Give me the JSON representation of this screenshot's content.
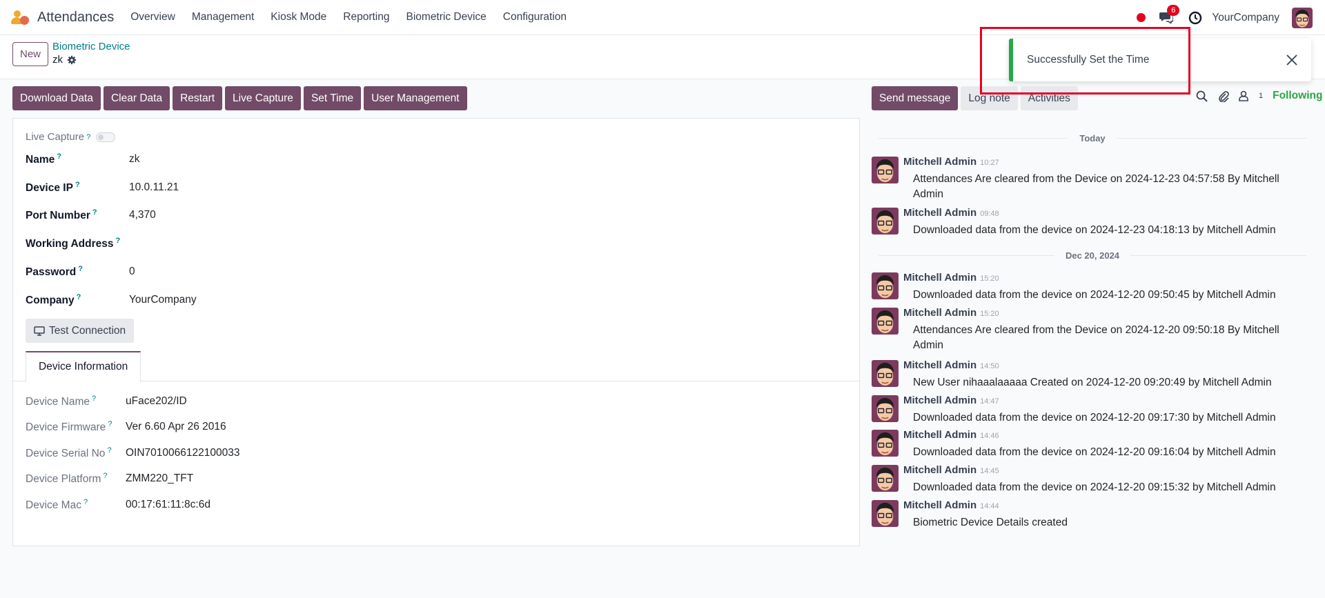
{
  "app": {
    "name": "Attendances"
  },
  "menu": [
    "Overview",
    "Management",
    "Kiosk Mode",
    "Reporting",
    "Biometric Device",
    "Configuration"
  ],
  "systray": {
    "chat_count": "6",
    "company": "YourCompany"
  },
  "control": {
    "new_label": "New",
    "breadcrumb_parent": "Biometric Device",
    "breadcrumb_current": "zk"
  },
  "actions": [
    "Download Data",
    "Clear Data",
    "Restart",
    "Live Capture",
    "Set Time",
    "User Management"
  ],
  "form": {
    "live_capture_label": "Live Capture",
    "fields": [
      {
        "label": "Name",
        "value": "zk"
      },
      {
        "label": "Device IP",
        "value": "10.0.11.21"
      },
      {
        "label": "Port Number",
        "value": "4,370"
      },
      {
        "label": "Working Address",
        "value": ""
      },
      {
        "label": "Password",
        "value": "0"
      },
      {
        "label": "Company",
        "value": "YourCompany"
      }
    ],
    "test_connection_label": "Test Connection",
    "tab_label": "Device Information",
    "device_info": [
      {
        "label": "Device Name",
        "value": "uFace202/ID"
      },
      {
        "label": "Device Firmware",
        "value": "Ver 6.60 Apr 26 2016"
      },
      {
        "label": "Device Serial No",
        "value": "OIN7010066122100033"
      },
      {
        "label": "Device Platform",
        "value": "ZMM220_TFT"
      },
      {
        "label": "Device Mac",
        "value": "00:17:61:11:8c:6d"
      }
    ]
  },
  "chatter": {
    "send_message": "Send message",
    "log_note": "Log note",
    "activities": "Activities",
    "follower_count": "1",
    "following": "Following",
    "date_today": "Today",
    "date_older": "Dec 20, 2024",
    "messages": [
      {
        "author": "Mitchell Admin",
        "time": "10:27",
        "body": "Attendances Are cleared from the Device on 2024-12-23 04:57:58 By Mitchell Admin"
      },
      {
        "author": "Mitchell Admin",
        "time": "09:48",
        "body": "Downloaded data from the device on 2024-12-23 04:18:13 by Mitchell Admin"
      },
      {
        "author": "Mitchell Admin",
        "time": "15:20",
        "body": "Downloaded data from the device on 2024-12-20 09:50:45 by Mitchell Admin"
      },
      {
        "author": "Mitchell Admin",
        "time": "15:20",
        "body": "Attendances Are cleared from the Device on 2024-12-20 09:50:18 By Mitchell Admin"
      },
      {
        "author": "Mitchell Admin",
        "time": "14:50",
        "body": "New User nihaaalaaaaa Created on 2024-12-20 09:20:49 by Mitchell Admin"
      },
      {
        "author": "Mitchell Admin",
        "time": "14:47",
        "body": "Downloaded data from the device on 2024-12-20 09:17:30 by Mitchell Admin"
      },
      {
        "author": "Mitchell Admin",
        "time": "14:46",
        "body": "Downloaded data from the device on 2024-12-20 09:16:04 by Mitchell Admin"
      },
      {
        "author": "Mitchell Admin",
        "time": "14:45",
        "body": "Downloaded data from the device on 2024-12-20 09:15:32 by Mitchell Admin"
      },
      {
        "author": "Mitchell Admin",
        "time": "14:44",
        "body": "Biometric Device Details created"
      }
    ]
  },
  "toast": {
    "message": "Successfully Set the Time"
  },
  "colors": {
    "primary": "#714b67",
    "link": "#017e84",
    "success": "#28a745",
    "danger": "#e0061f"
  }
}
